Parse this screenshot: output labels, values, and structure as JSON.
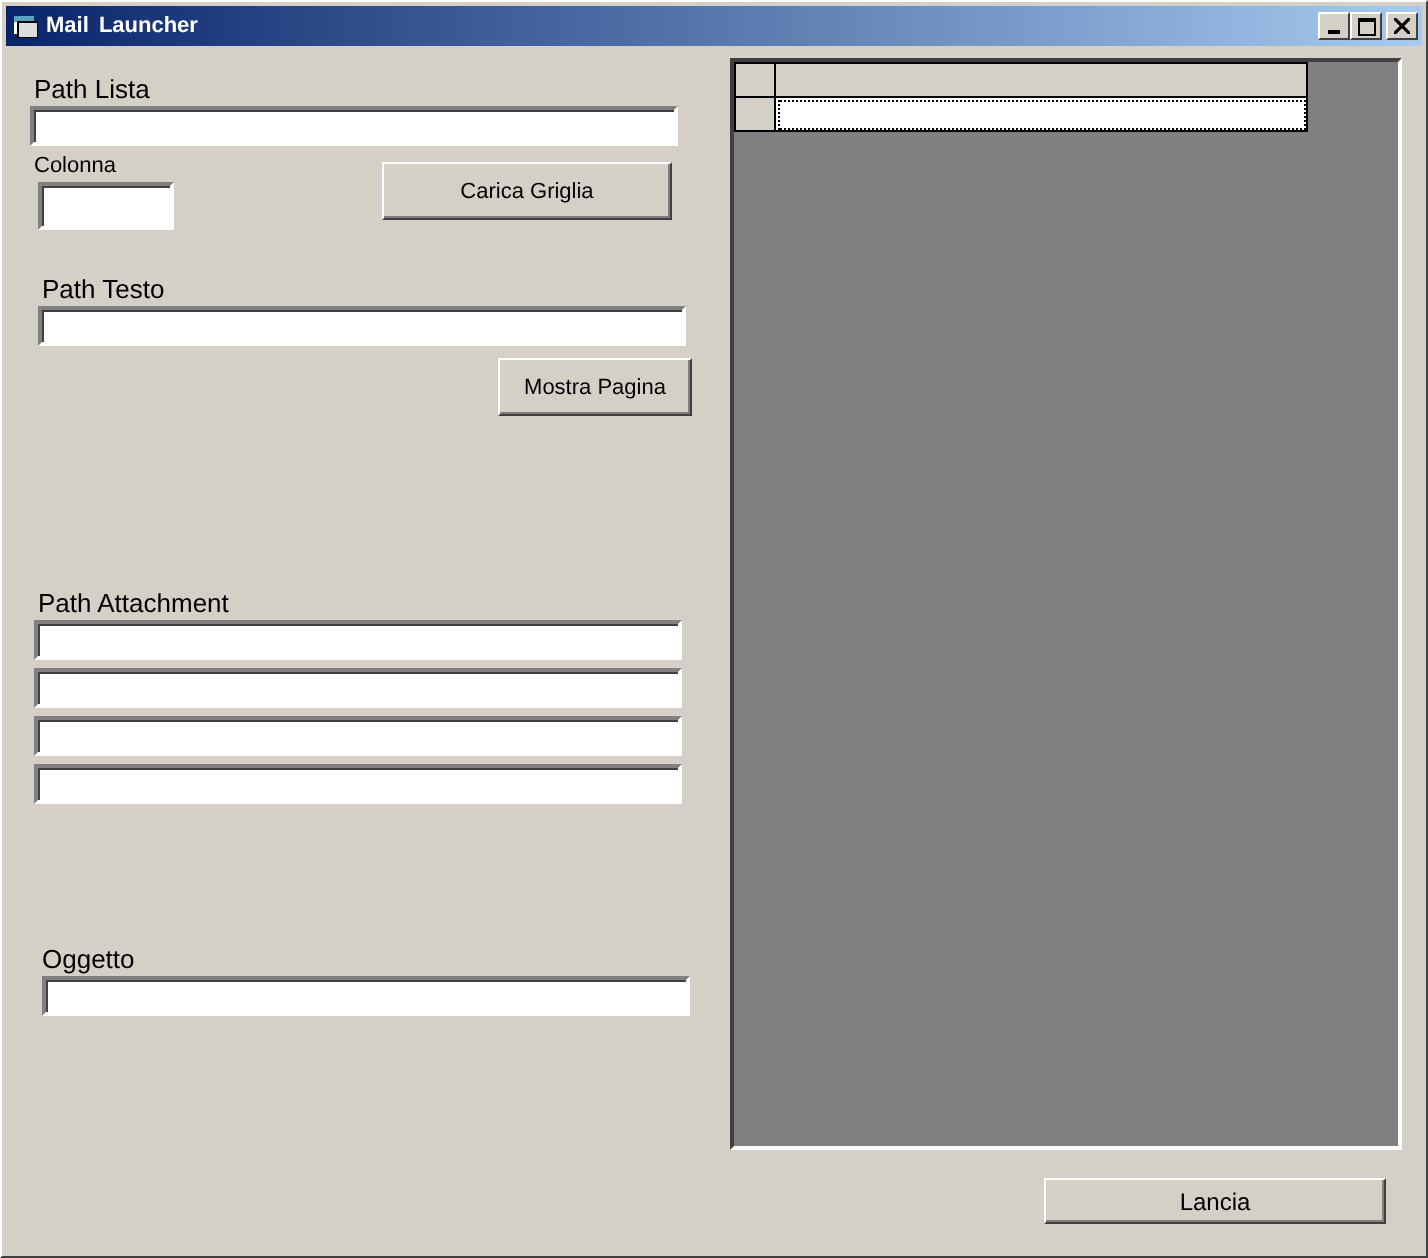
{
  "window": {
    "title": "Mail Launcher"
  },
  "path_lista": {
    "label": "Path Lista"
  },
  "colonna": {
    "label": "Colonna"
  },
  "carica_button": "Carica Griglia",
  "path_testo": {
    "label": "Path Testo"
  },
  "mostra_button": "Mostra Pagina",
  "path_attachment": {
    "label": "Path Attachment",
    "fields": [
      {
        "kind": "input"
      },
      {
        "kind": "input"
      },
      {
        "kind": "input"
      },
      {
        "kind": "input"
      }
    ]
  },
  "oggetto": {
    "label": "Oggetto"
  },
  "grid": {
    "rows": [
      {
        "selected": true
      }
    ]
  },
  "lancia_button": "Lancia"
}
